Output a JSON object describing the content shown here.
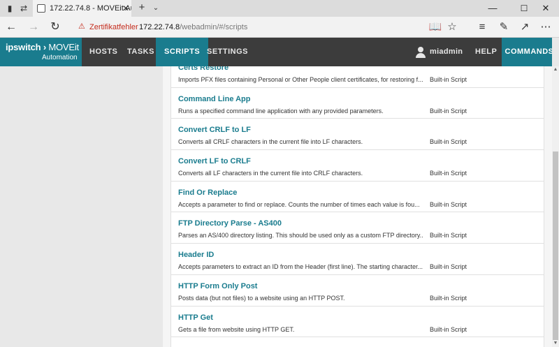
{
  "browser": {
    "tab_title": "172.22.74.8 - MOVEit Au",
    "cert_warning": "Zertifikatfehler",
    "url_host": "172.22.74.8",
    "url_path": "/webadmin/#/scripts"
  },
  "header": {
    "logo_main": "ipswitch",
    "logo_sub1": "MOVEit",
    "logo_sub2": "Automation",
    "nav": [
      "HOSTS",
      "TASKS",
      "SCRIPTS",
      "SETTINGS"
    ],
    "user": "miadmin",
    "help": "HELP",
    "commands": "COMMANDS",
    "colors": {
      "brand": "#1a7c8e",
      "bar": "#3c3c3c"
    }
  },
  "scripts": [
    {
      "name": "Certs Restore",
      "description": "Imports PFX files containing Personal or Other People client certificates, for restoring f...",
      "type": "Built-in Script"
    },
    {
      "name": "Command Line App",
      "description": "Runs a specified command line application with any provided parameters.",
      "type": "Built-in Script"
    },
    {
      "name": "Convert CRLF to LF",
      "description": "Converts all CRLF characters in the current file into LF characters.",
      "type": "Built-in Script"
    },
    {
      "name": "Convert LF to CRLF",
      "description": "Converts all LF characters in the current file into CRLF characters.",
      "type": "Built-in Script"
    },
    {
      "name": "Find Or Replace",
      "description": "Accepts a parameter to find or replace. Counts the number of times each value is fou...",
      "type": "Built-in Script"
    },
    {
      "name": "FTP Directory Parse - AS400",
      "description": "Parses an AS/400 directory listing. This should be used only as a custom FTP directory...",
      "type": "Built-in Script"
    },
    {
      "name": "Header ID",
      "description": "Accepts parameters to extract an ID from the Header (first line). The starting character...",
      "type": "Built-in Script"
    },
    {
      "name": "HTTP Form Only Post",
      "description": "Posts data (but not files) to a website using an HTTP POST.",
      "type": "Built-in Script"
    },
    {
      "name": "HTTP Get",
      "description": "Gets a file from website using HTTP GET.",
      "type": "Built-in Script"
    }
  ]
}
